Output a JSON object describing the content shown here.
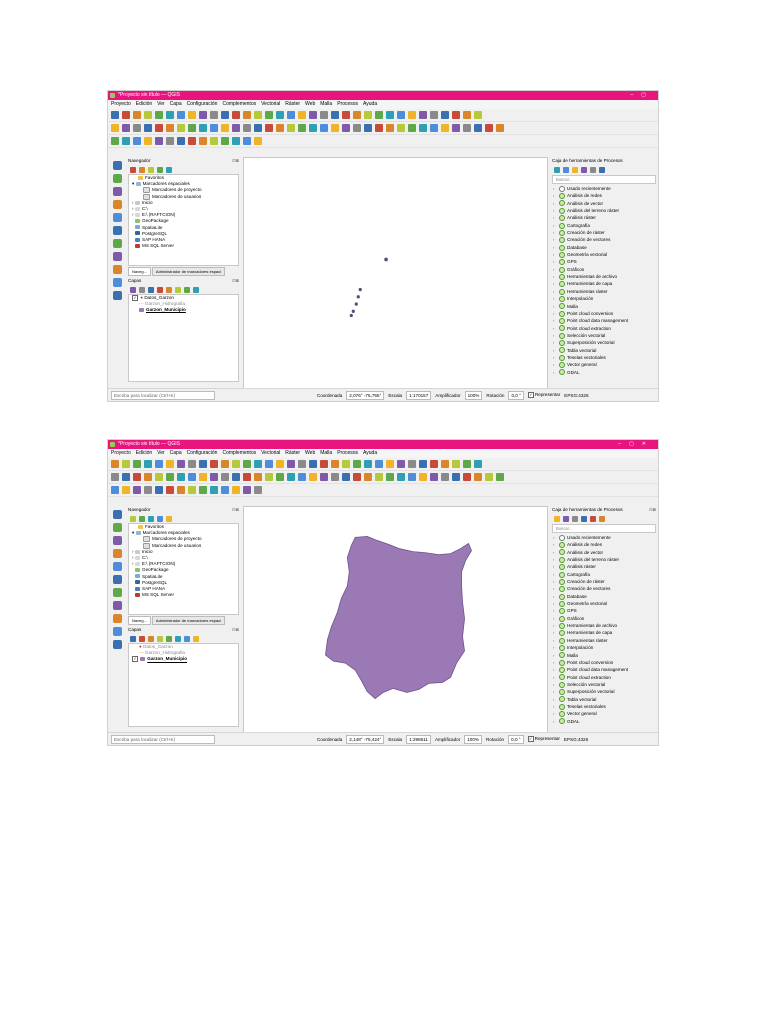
{
  "screens": [
    {
      "title": "*Proyecto sin título — QGIS",
      "menus": [
        "Proyecto",
        "Edición",
        "Ver",
        "Capa",
        "Configuración",
        "Complementos",
        "Vectorial",
        "Ráster",
        "Web",
        "Malla",
        "Procesos",
        "Ayuda"
      ],
      "browser": {
        "title": "Navegador",
        "items": [
          "Favoritos",
          "Marcadores espaciales",
          "Marcadores de proyecto",
          "Marcadores de usuarios",
          "Inicio",
          "C:\\",
          "E:\\ (RAFTCION)",
          "GeoPackage",
          "SpatiaLite",
          "PostgreSQL",
          "SAP HANA",
          "MS SQL Server"
        ],
        "tabs": [
          "Naveg...",
          "Administrador de marcadores espaci"
        ]
      },
      "layers": {
        "title": "Capas",
        "items": [
          "Datos_Garzon",
          "Garzon_Hidrografia",
          "Garzon_Municipio"
        ]
      },
      "toolbox": {
        "title": "Caja de herramientas de Procesos",
        "search_placeholder": "Buscar...",
        "items": [
          "Usado recientemente",
          "Análisis de redes",
          "Análisis de vector",
          "Análisis del terreno ráster",
          "Análisis ráster",
          "Cartografía",
          "Creación de ráster",
          "Creación de vectores",
          "Database",
          "Geometría vectorial",
          "GPS",
          "Gráficos",
          "Herramientas de archivo",
          "Herramientas de capa",
          "Herramientas ráster",
          "Interpolación",
          "Malla",
          "Point cloud conversion",
          "Point cloud data management",
          "Point cloud extraction",
          "Selección vectorial",
          "Superposición vectorial",
          "Tabla vectorial",
          "Teselas vectoriales",
          "Vector general",
          "GDAL"
        ]
      },
      "status": {
        "locator_placeholder": "Escriba para localizar (Ctrl+K)",
        "coord_label": "Coordenada",
        "coord_value": "2,076° -75,755°",
        "scale_label": "Escala",
        "scale_value": "1:170157",
        "magnifier_label": "Amplificador",
        "magnifier_value": "100%",
        "rotation_label": "Rotación",
        "rotation_value": "0,0 °",
        "render_label": "Representar",
        "crs": "EPSG:4326"
      }
    },
    {
      "title": "*Proyecto sin título — QGIS",
      "menus": [
        "Proyecto",
        "Edición",
        "Ver",
        "Capa",
        "Configuración",
        "Complementos",
        "Vectorial",
        "Ráster",
        "Web",
        "Malla",
        "Procesos",
        "Ayuda"
      ],
      "browser": {
        "title": "Navegador",
        "items": [
          "Favoritos",
          "Marcadores espaciales",
          "Marcadores de proyecto",
          "Marcadores de usuarios",
          "Inicio",
          "C:\\",
          "E:\\ (RAFTCION)",
          "GeoPackage",
          "SpatiaLite",
          "PostgreSQL",
          "SAP HANA",
          "MS SQL Server"
        ],
        "tabs": [
          "Naveg...",
          "Administrador de marcadores espaci"
        ]
      },
      "layers": {
        "title": "Capas",
        "items": [
          "Datos_Garzon",
          "Garzon_Hidrografia",
          "Garzon_Municipio"
        ]
      },
      "toolbox": {
        "title": "Caja de herramientas de Procesos",
        "search_placeholder": "Buscar...",
        "items": [
          "Usado recientemente",
          "Análisis de redes",
          "Análisis de vector",
          "Análisis del terreno ráster",
          "Análisis ráster",
          "Cartografía",
          "Creación de ráster",
          "Creación de vectores",
          "Database",
          "Geometría vectorial",
          "GPS",
          "Gráficos",
          "Herramientas de archivo",
          "Herramientas de capa",
          "Herramientas ráster",
          "Interpolación",
          "Malla",
          "Point cloud conversion",
          "Point cloud data management",
          "Point cloud extraction",
          "Selección vectorial",
          "Superposición vectorial",
          "Tabla vectorial",
          "Teselas vectoriales",
          "Vector general",
          "GDAL"
        ]
      },
      "status": {
        "locator_placeholder": "Escriba para localizar (Ctrl+K)",
        "coord_label": "Coordenada",
        "coord_value": "2,148° -75,424°",
        "scale_label": "Escala",
        "scale_value": "1:298611",
        "magnifier_label": "Amplificador",
        "magnifier_value": "100%",
        "rotation_label": "Rotación",
        "rotation_value": "0,0 °",
        "render_label": "Representar",
        "crs": "EPSG:4326"
      }
    }
  ],
  "colors": {
    "titlebar": "#e8157e",
    "polygon_fill": "#9a79b4",
    "polygon_stroke": "#6f5290",
    "point": "#5a4a78"
  }
}
